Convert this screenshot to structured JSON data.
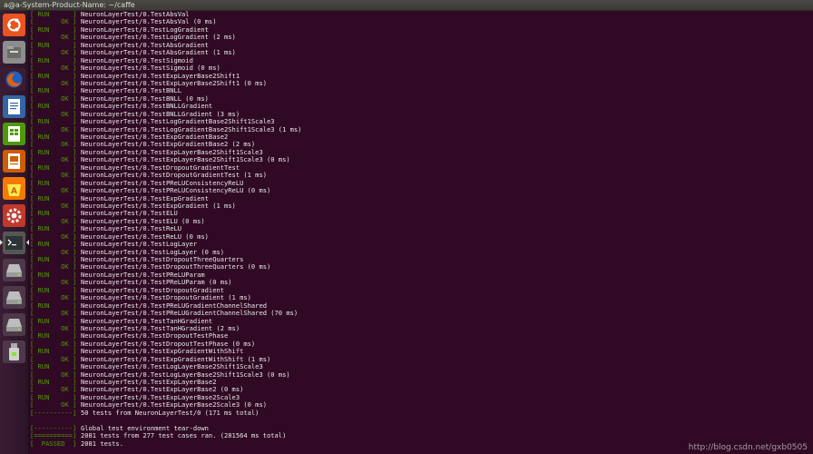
{
  "window": {
    "title": "a@a-System-Product-Name: ~/caffe"
  },
  "launcher": {
    "items": [
      {
        "icon": "ubuntu-dash-icon",
        "color": "#e95420"
      },
      {
        "icon": "files-icon",
        "color": "#8d8d8d"
      },
      {
        "icon": "firefox-icon",
        "color": "#e66000"
      },
      {
        "icon": "writer-icon",
        "color": "#3465a4"
      },
      {
        "icon": "calc-icon",
        "color": "#4e9a06"
      },
      {
        "icon": "impress-icon",
        "color": "#ce5c00"
      },
      {
        "icon": "software-center-icon",
        "color": "#f57900"
      },
      {
        "icon": "settings-icon",
        "color": "#c0392b"
      },
      {
        "icon": "terminal-icon",
        "color": "#2e3436"
      },
      {
        "icon": "drive-icon",
        "color": "#bdbdbd"
      },
      {
        "icon": "drive-icon",
        "color": "#bdbdbd"
      },
      {
        "icon": "drive-icon",
        "color": "#bdbdbd"
      },
      {
        "icon": "usb-drive-icon",
        "color": "#d0d0d0"
      }
    ]
  },
  "terminal": {
    "lines": [
      {
        "tag": "[ RUN      ]",
        "text": "NeuronLayerTest/0.TestAbsVal"
      },
      {
        "tag": "[       OK ]",
        "text": "NeuronLayerTest/0.TestAbsVal (0 ms)"
      },
      {
        "tag": "[ RUN      ]",
        "text": "NeuronLayerTest/0.TestLogGradient"
      },
      {
        "tag": "[       OK ]",
        "text": "NeuronLayerTest/0.TestLogGradient (2 ms)"
      },
      {
        "tag": "[ RUN      ]",
        "text": "NeuronLayerTest/0.TestAbsGradient"
      },
      {
        "tag": "[       OK ]",
        "text": "NeuronLayerTest/0.TestAbsGradient (1 ms)"
      },
      {
        "tag": "[ RUN      ]",
        "text": "NeuronLayerTest/0.TestSigmoid"
      },
      {
        "tag": "[       OK ]",
        "text": "NeuronLayerTest/0.TestSigmoid (0 ms)"
      },
      {
        "tag": "[ RUN      ]",
        "text": "NeuronLayerTest/0.TestExpLayerBase2Shift1"
      },
      {
        "tag": "[       OK ]",
        "text": "NeuronLayerTest/0.TestExpLayerBase2Shift1 (0 ms)"
      },
      {
        "tag": "[ RUN      ]",
        "text": "NeuronLayerTest/0.TestBNLL"
      },
      {
        "tag": "[       OK ]",
        "text": "NeuronLayerTest/0.TestBNLL (0 ms)"
      },
      {
        "tag": "[ RUN      ]",
        "text": "NeuronLayerTest/0.TestBNLLGradient"
      },
      {
        "tag": "[       OK ]",
        "text": "NeuronLayerTest/0.TestBNLLGradient (3 ms)"
      },
      {
        "tag": "[ RUN      ]",
        "text": "NeuronLayerTest/0.TestLogGradientBase2Shift1Scale3"
      },
      {
        "tag": "[       OK ]",
        "text": "NeuronLayerTest/0.TestLogGradientBase2Shift1Scale3 (1 ms)"
      },
      {
        "tag": "[ RUN      ]",
        "text": "NeuronLayerTest/0.TestExpGradientBase2"
      },
      {
        "tag": "[       OK ]",
        "text": "NeuronLayerTest/0.TestExpGradientBase2 (2 ms)"
      },
      {
        "tag": "[ RUN      ]",
        "text": "NeuronLayerTest/0.TestExpLayerBase2Shift1Scale3"
      },
      {
        "tag": "[       OK ]",
        "text": "NeuronLayerTest/0.TestExpLayerBase2Shift1Scale3 (0 ms)"
      },
      {
        "tag": "[ RUN      ]",
        "text": "NeuronLayerTest/0.TestDropoutGradientTest"
      },
      {
        "tag": "[       OK ]",
        "text": "NeuronLayerTest/0.TestDropoutGradientTest (1 ms)"
      },
      {
        "tag": "[ RUN      ]",
        "text": "NeuronLayerTest/0.TestPReLUConsistencyReLU"
      },
      {
        "tag": "[       OK ]",
        "text": "NeuronLayerTest/0.TestPReLUConsistencyReLU (0 ms)"
      },
      {
        "tag": "[ RUN      ]",
        "text": "NeuronLayerTest/0.TestExpGradient"
      },
      {
        "tag": "[       OK ]",
        "text": "NeuronLayerTest/0.TestExpGradient (1 ms)"
      },
      {
        "tag": "[ RUN      ]",
        "text": "NeuronLayerTest/0.TestELU"
      },
      {
        "tag": "[       OK ]",
        "text": "NeuronLayerTest/0.TestELU (0 ms)"
      },
      {
        "tag": "[ RUN      ]",
        "text": "NeuronLayerTest/0.TestReLU"
      },
      {
        "tag": "[       OK ]",
        "text": "NeuronLayerTest/0.TestReLU (0 ms)"
      },
      {
        "tag": "[ RUN      ]",
        "text": "NeuronLayerTest/0.TestLogLayer"
      },
      {
        "tag": "[       OK ]",
        "text": "NeuronLayerTest/0.TestLogLayer (0 ms)"
      },
      {
        "tag": "[ RUN      ]",
        "text": "NeuronLayerTest/0.TestDropoutThreeQuarters"
      },
      {
        "tag": "[       OK ]",
        "text": "NeuronLayerTest/0.TestDropoutThreeQuarters (0 ms)"
      },
      {
        "tag": "[ RUN      ]",
        "text": "NeuronLayerTest/0.TestPReLUParam"
      },
      {
        "tag": "[       OK ]",
        "text": "NeuronLayerTest/0.TestPReLUParam (0 ms)"
      },
      {
        "tag": "[ RUN      ]",
        "text": "NeuronLayerTest/0.TestDropoutGradient"
      },
      {
        "tag": "[       OK ]",
        "text": "NeuronLayerTest/0.TestDropoutGradient (1 ms)"
      },
      {
        "tag": "[ RUN      ]",
        "text": "NeuronLayerTest/0.TestPReLUGradientChannelShared"
      },
      {
        "tag": "[       OK ]",
        "text": "NeuronLayerTest/0.TestPReLUGradientChannelShared (70 ms)"
      },
      {
        "tag": "[ RUN      ]",
        "text": "NeuronLayerTest/0.TestTanHGradient"
      },
      {
        "tag": "[       OK ]",
        "text": "NeuronLayerTest/0.TestTanHGradient (2 ms)"
      },
      {
        "tag": "[ RUN      ]",
        "text": "NeuronLayerTest/0.TestDropoutTestPhase"
      },
      {
        "tag": "[       OK ]",
        "text": "NeuronLayerTest/0.TestDropoutTestPhase (0 ms)"
      },
      {
        "tag": "[ RUN      ]",
        "text": "NeuronLayerTest/0.TestExpGradientWithShift"
      },
      {
        "tag": "[       OK ]",
        "text": "NeuronLayerTest/0.TestExpGradientWithShift (1 ms)"
      },
      {
        "tag": "[ RUN      ]",
        "text": "NeuronLayerTest/0.TestLogLayerBase2Shift1Scale3"
      },
      {
        "tag": "[       OK ]",
        "text": "NeuronLayerTest/0.TestLogLayerBase2Shift1Scale3 (0 ms)"
      },
      {
        "tag": "[ RUN      ]",
        "text": "NeuronLayerTest/0.TestExpLayerBase2"
      },
      {
        "tag": "[       OK ]",
        "text": "NeuronLayerTest/0.TestExpLayerBase2 (0 ms)"
      },
      {
        "tag": "[ RUN      ]",
        "text": "NeuronLayerTest/0.TestExpLayerBase2Scale3"
      },
      {
        "tag": "[       OK ]",
        "text": "NeuronLayerTest/0.TestExpLayerBase2Scale3 (0 ms)"
      },
      {
        "tag": "[----------]",
        "text": "50 tests from NeuronLayerTest/0 (171 ms total)"
      },
      {
        "tag": "",
        "text": ""
      },
      {
        "tag": "[----------]",
        "text": "Global test environment tear-down"
      },
      {
        "tag": "[==========]",
        "text": "2081 tests from 277 test cases ran. (281564 ms total)"
      },
      {
        "tag": "[  PASSED  ]",
        "text": "2081 tests."
      }
    ]
  },
  "watermark": "http://blog.csdn.net/gxb0505"
}
